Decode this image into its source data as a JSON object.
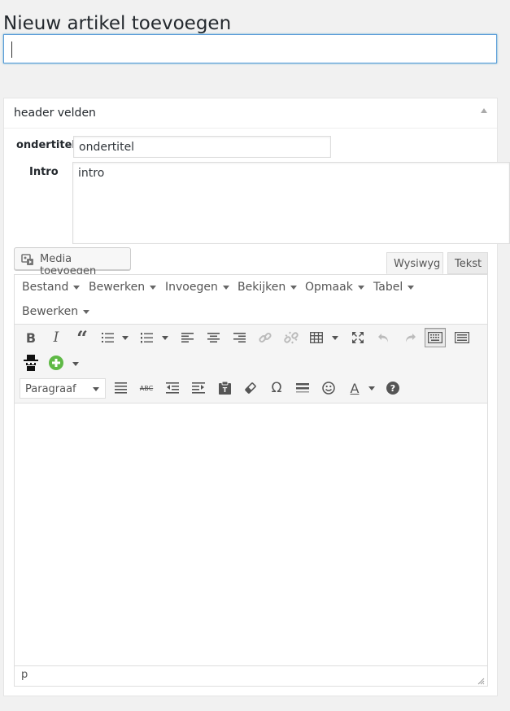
{
  "page": {
    "title": "Nieuw artikel toevoegen"
  },
  "title_input": {
    "value": ""
  },
  "metabox": {
    "title": "header velden",
    "subtitle_label": "ondertitel",
    "subtitle_value": "ondertitel",
    "intro_label": "Intro",
    "intro_value": "intro"
  },
  "editor": {
    "media_button": "Media toevoegen",
    "tabs": {
      "visual": "Wysiwyg",
      "text": "Tekst"
    },
    "menubar": [
      "Bestand",
      "Bewerken",
      "Invoegen",
      "Bekijken",
      "Opmaak",
      "Tabel",
      "Bewerken"
    ],
    "format_select": "Paragraaf",
    "status_path": "p",
    "toolbar_row1": [
      "bold-icon",
      "italic-icon",
      "blockquote-icon",
      "bullet-list-icon",
      "numbered-list-icon",
      "align-left-icon",
      "align-center-icon",
      "align-right-icon",
      "link-icon",
      "unlink-icon",
      "table-icon",
      "fullscreen-icon",
      "undo-icon",
      "redo-icon",
      "toolbar-toggle-icon",
      "keyboard-icon"
    ],
    "toolbar_row2": [
      "spy-icon",
      "add-icon"
    ],
    "toolbar_row3": [
      "justify-icon",
      "strikethrough-icon",
      "outdent-icon",
      "indent-icon",
      "paste-text-icon",
      "clear-format-icon",
      "special-char-icon",
      "horizontal-line-icon",
      "emoticon-icon",
      "text-color-icon",
      "help-icon"
    ]
  },
  "colors": {
    "accent": "#5b9dd9",
    "add_green": "#5fb946"
  }
}
